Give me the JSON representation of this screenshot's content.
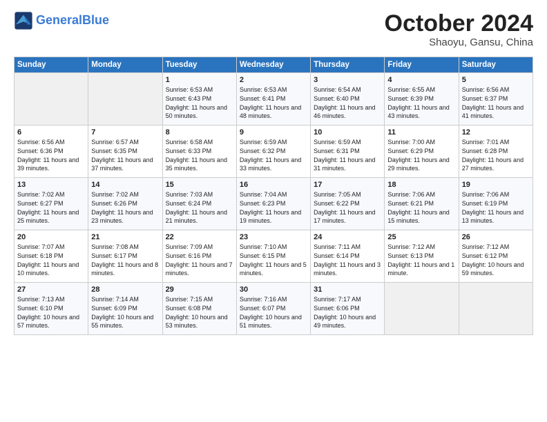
{
  "header": {
    "logo_line1": "General",
    "logo_line2": "Blue",
    "month": "October 2024",
    "location": "Shaoyu, Gansu, China"
  },
  "weekdays": [
    "Sunday",
    "Monday",
    "Tuesday",
    "Wednesday",
    "Thursday",
    "Friday",
    "Saturday"
  ],
  "weeks": [
    [
      {
        "day": "",
        "empty": true
      },
      {
        "day": "",
        "empty": true
      },
      {
        "day": "1",
        "sunrise": "6:53 AM",
        "sunset": "6:43 PM",
        "daylight": "11 hours and 50 minutes."
      },
      {
        "day": "2",
        "sunrise": "6:53 AM",
        "sunset": "6:41 PM",
        "daylight": "11 hours and 48 minutes."
      },
      {
        "day": "3",
        "sunrise": "6:54 AM",
        "sunset": "6:40 PM",
        "daylight": "11 hours and 46 minutes."
      },
      {
        "day": "4",
        "sunrise": "6:55 AM",
        "sunset": "6:39 PM",
        "daylight": "11 hours and 43 minutes."
      },
      {
        "day": "5",
        "sunrise": "6:56 AM",
        "sunset": "6:37 PM",
        "daylight": "11 hours and 41 minutes."
      }
    ],
    [
      {
        "day": "6",
        "sunrise": "6:56 AM",
        "sunset": "6:36 PM",
        "daylight": "11 hours and 39 minutes."
      },
      {
        "day": "7",
        "sunrise": "6:57 AM",
        "sunset": "6:35 PM",
        "daylight": "11 hours and 37 minutes."
      },
      {
        "day": "8",
        "sunrise": "6:58 AM",
        "sunset": "6:33 PM",
        "daylight": "11 hours and 35 minutes."
      },
      {
        "day": "9",
        "sunrise": "6:59 AM",
        "sunset": "6:32 PM",
        "daylight": "11 hours and 33 minutes."
      },
      {
        "day": "10",
        "sunrise": "6:59 AM",
        "sunset": "6:31 PM",
        "daylight": "11 hours and 31 minutes."
      },
      {
        "day": "11",
        "sunrise": "7:00 AM",
        "sunset": "6:29 PM",
        "daylight": "11 hours and 29 minutes."
      },
      {
        "day": "12",
        "sunrise": "7:01 AM",
        "sunset": "6:28 PM",
        "daylight": "11 hours and 27 minutes."
      }
    ],
    [
      {
        "day": "13",
        "sunrise": "7:02 AM",
        "sunset": "6:27 PM",
        "daylight": "11 hours and 25 minutes."
      },
      {
        "day": "14",
        "sunrise": "7:02 AM",
        "sunset": "6:26 PM",
        "daylight": "11 hours and 23 minutes."
      },
      {
        "day": "15",
        "sunrise": "7:03 AM",
        "sunset": "6:24 PM",
        "daylight": "11 hours and 21 minutes."
      },
      {
        "day": "16",
        "sunrise": "7:04 AM",
        "sunset": "6:23 PM",
        "daylight": "11 hours and 19 minutes."
      },
      {
        "day": "17",
        "sunrise": "7:05 AM",
        "sunset": "6:22 PM",
        "daylight": "11 hours and 17 minutes."
      },
      {
        "day": "18",
        "sunrise": "7:06 AM",
        "sunset": "6:21 PM",
        "daylight": "11 hours and 15 minutes."
      },
      {
        "day": "19",
        "sunrise": "7:06 AM",
        "sunset": "6:19 PM",
        "daylight": "11 hours and 13 minutes."
      }
    ],
    [
      {
        "day": "20",
        "sunrise": "7:07 AM",
        "sunset": "6:18 PM",
        "daylight": "11 hours and 10 minutes."
      },
      {
        "day": "21",
        "sunrise": "7:08 AM",
        "sunset": "6:17 PM",
        "daylight": "11 hours and 8 minutes."
      },
      {
        "day": "22",
        "sunrise": "7:09 AM",
        "sunset": "6:16 PM",
        "daylight": "11 hours and 7 minutes."
      },
      {
        "day": "23",
        "sunrise": "7:10 AM",
        "sunset": "6:15 PM",
        "daylight": "11 hours and 5 minutes."
      },
      {
        "day": "24",
        "sunrise": "7:11 AM",
        "sunset": "6:14 PM",
        "daylight": "11 hours and 3 minutes."
      },
      {
        "day": "25",
        "sunrise": "7:12 AM",
        "sunset": "6:13 PM",
        "daylight": "11 hours and 1 minute."
      },
      {
        "day": "26",
        "sunrise": "7:12 AM",
        "sunset": "6:12 PM",
        "daylight": "10 hours and 59 minutes."
      }
    ],
    [
      {
        "day": "27",
        "sunrise": "7:13 AM",
        "sunset": "6:10 PM",
        "daylight": "10 hours and 57 minutes."
      },
      {
        "day": "28",
        "sunrise": "7:14 AM",
        "sunset": "6:09 PM",
        "daylight": "10 hours and 55 minutes."
      },
      {
        "day": "29",
        "sunrise": "7:15 AM",
        "sunset": "6:08 PM",
        "daylight": "10 hours and 53 minutes."
      },
      {
        "day": "30",
        "sunrise": "7:16 AM",
        "sunset": "6:07 PM",
        "daylight": "10 hours and 51 minutes."
      },
      {
        "day": "31",
        "sunrise": "7:17 AM",
        "sunset": "6:06 PM",
        "daylight": "10 hours and 49 minutes."
      },
      {
        "day": "",
        "empty": true
      },
      {
        "day": "",
        "empty": true
      }
    ]
  ]
}
